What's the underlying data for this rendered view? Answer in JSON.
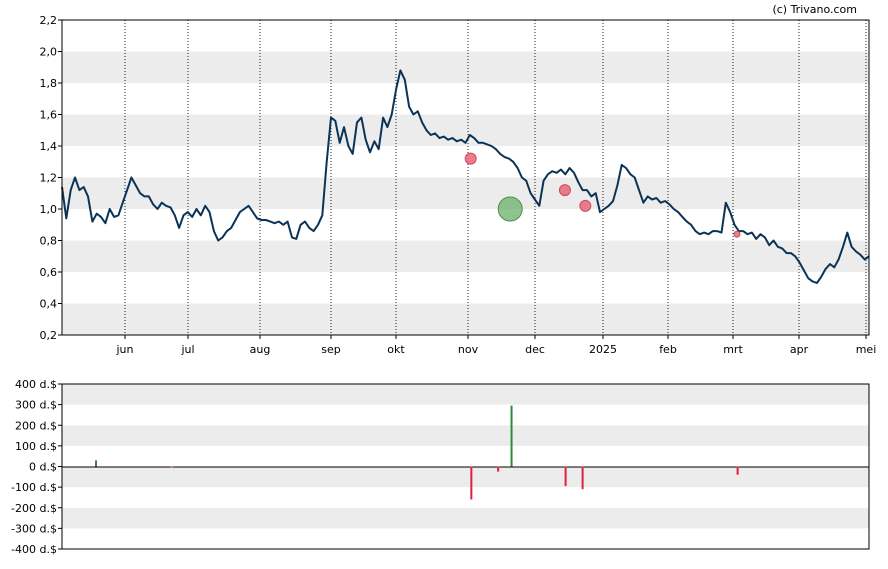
{
  "watermark": "(c) Trivano.com",
  "chart_data": [
    {
      "type": "line",
      "ylim": [
        0.2,
        2.2
      ],
      "yticks": [
        "0,2",
        "0,4",
        "0,6",
        "0,8",
        "1,0",
        "1,2",
        "1,4",
        "1,6",
        "1,8",
        "2,0",
        "2,2"
      ],
      "months": [
        "jun",
        "jul",
        "aug",
        "sep",
        "okt",
        "nov",
        "dec",
        "2025",
        "feb",
        "mrt",
        "apr",
        "mei"
      ],
      "grid": "horizontal bands, dotted vertical month lines",
      "line_color": "#0b3356",
      "series": [
        {
          "values": [
            1.14,
            0.94,
            1.12,
            1.2,
            1.12,
            1.14,
            1.08,
            0.92,
            0.97,
            0.95,
            0.91,
            1.0,
            0.95,
            0.96,
            1.04,
            1.12,
            1.2,
            1.15,
            1.1,
            1.08,
            1.08,
            1.03,
            1.0,
            1.04,
            1.02,
            1.01,
            0.96,
            0.88,
            0.96,
            0.98,
            0.95,
            1.0,
            0.96,
            1.02,
            0.98,
            0.86,
            0.8,
            0.82,
            0.86,
            0.88,
            0.93,
            0.98,
            1.0,
            1.02,
            0.98,
            0.94,
            0.93,
            0.93,
            0.92,
            0.91,
            0.92,
            0.9,
            0.92,
            0.82,
            0.81,
            0.9,
            0.92,
            0.88,
            0.86,
            0.9,
            0.96,
            1.3,
            1.58,
            1.56,
            1.42,
            1.52,
            1.4,
            1.35,
            1.55,
            1.58,
            1.44,
            1.36,
            1.43,
            1.38,
            1.58,
            1.52,
            1.6,
            1.76,
            1.88,
            1.82,
            1.65,
            1.6,
            1.62,
            1.55,
            1.5,
            1.47,
            1.48,
            1.45,
            1.46,
            1.44,
            1.45,
            1.43,
            1.44,
            1.42,
            1.47,
            1.45,
            1.42,
            1.42,
            1.41,
            1.4,
            1.38,
            1.35,
            1.33,
            1.32,
            1.3,
            1.26,
            1.2,
            1.18,
            1.1,
            1.06,
            1.02,
            1.18,
            1.22,
            1.24,
            1.23,
            1.25,
            1.22,
            1.26,
            1.23,
            1.17,
            1.12,
            1.12,
            1.08,
            1.1,
            0.98,
            1.0,
            1.02,
            1.05,
            1.15,
            1.28,
            1.26,
            1.22,
            1.2,
            1.12,
            1.04,
            1.08,
            1.06,
            1.07,
            1.04,
            1.05,
            1.03,
            1.0,
            0.98,
            0.95,
            0.92,
            0.9,
            0.86,
            0.84,
            0.85,
            0.84,
            0.86,
            0.86,
            0.85,
            1.04,
            0.98,
            0.9,
            0.86,
            0.86,
            0.84,
            0.85,
            0.81,
            0.84,
            0.82,
            0.77,
            0.8,
            0.76,
            0.75,
            0.72,
            0.72,
            0.7,
            0.66,
            0.61,
            0.56,
            0.54,
            0.53,
            0.57,
            0.62,
            0.65,
            0.63,
            0.68,
            0.76,
            0.85,
            0.76,
            0.73,
            0.71,
            0.68,
            0.7
          ]
        }
      ],
      "markers": [
        {
          "type": "sell",
          "x_month_index": 5.04,
          "value": 1.32,
          "size": "small",
          "color": "#e8667a"
        },
        {
          "type": "buy",
          "x_month_index": 5.63,
          "value": 1.0,
          "size": "large",
          "color": "#6aaf6a"
        },
        {
          "type": "sell",
          "x_month_index": 6.44,
          "value": 1.12,
          "size": "small",
          "color": "#e8667a"
        },
        {
          "type": "sell",
          "x_month_index": 6.74,
          "value": 1.02,
          "size": "small",
          "color": "#e8667a"
        },
        {
          "type": "sell",
          "x_month_index": 9.06,
          "value": 0.84,
          "size": "tiny",
          "color": "#e8667a"
        }
      ]
    },
    {
      "type": "bar",
      "ylim": [
        -400,
        400
      ],
      "yticks": [
        "400 d.$",
        "300 d.$",
        "200 d.$",
        "100 d.$",
        "0 d.$",
        "-100 d.$",
        "-200 d.$",
        "-300 d.$",
        "-400 d.$"
      ],
      "bars": [
        {
          "x_month_index": -0.46,
          "value": 30,
          "color": "#2e8b3e"
        },
        {
          "x_month_index": 0.74,
          "value": -5,
          "color": "#e0203a"
        },
        {
          "x_month_index": 5.05,
          "value": -160,
          "color": "#e0203a"
        },
        {
          "x_month_index": 5.45,
          "value": -25,
          "color": "#e0203a"
        },
        {
          "x_month_index": 5.65,
          "value": 295,
          "color": "#2e8b3e"
        },
        {
          "x_month_index": 6.45,
          "value": -95,
          "color": "#e0203a"
        },
        {
          "x_month_index": 6.7,
          "value": -110,
          "color": "#e0203a"
        },
        {
          "x_month_index": 9.07,
          "value": -40,
          "color": "#e0203a"
        }
      ]
    }
  ]
}
